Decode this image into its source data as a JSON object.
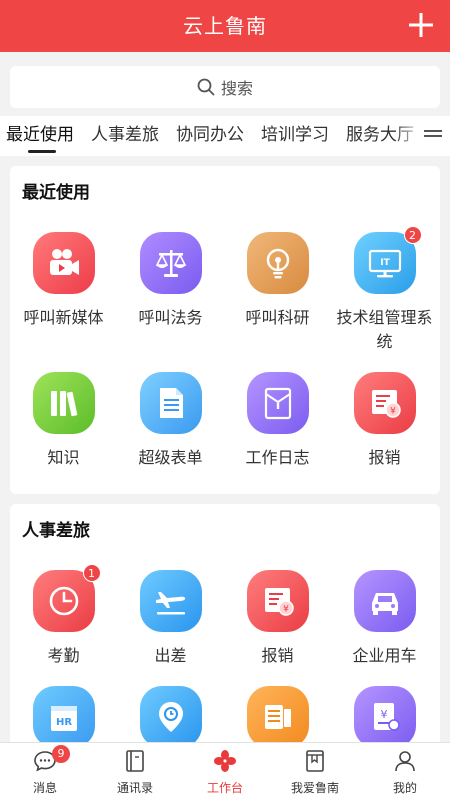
{
  "header": {
    "title": "云上鲁南",
    "add_icon": "plus-icon"
  },
  "search": {
    "placeholder": "搜索",
    "icon": "search-icon"
  },
  "tabs": [
    {
      "label": "最近使用",
      "active": true
    },
    {
      "label": "人事差旅"
    },
    {
      "label": "协同办公"
    },
    {
      "label": "培训学习"
    },
    {
      "label": "服务大厅"
    }
  ],
  "tabs_more_icon": "menu-icon",
  "recent": {
    "title": "最近使用",
    "items": [
      {
        "label": "呼叫新媒体",
        "icon": "video-camera-icon"
      },
      {
        "label": "呼叫法务",
        "icon": "scale-icon"
      },
      {
        "label": "呼叫科研",
        "icon": "lightbulb-icon"
      },
      {
        "label": "技术组管理系统",
        "icon": "it-monitor-icon",
        "badge": "2"
      },
      {
        "label": "知识",
        "icon": "books-icon"
      },
      {
        "label": "超级表单",
        "icon": "form-document-icon"
      },
      {
        "label": "工作日志",
        "icon": "journal-icon"
      },
      {
        "label": "报销",
        "icon": "invoice-icon"
      }
    ]
  },
  "hr_travel": {
    "title": "人事差旅",
    "items": [
      {
        "label": "考勤",
        "icon": "clock-icon",
        "badge": "1"
      },
      {
        "label": "出差",
        "icon": "airplane-icon"
      },
      {
        "label": "报销",
        "icon": "invoice-icon"
      },
      {
        "label": "企业用车",
        "icon": "car-icon"
      },
      {
        "label": "",
        "icon": "hr-folder-icon"
      },
      {
        "label": "",
        "icon": "location-pin-icon"
      },
      {
        "label": "",
        "icon": "ticket-icon"
      },
      {
        "label": "",
        "icon": "yuan-document-icon"
      }
    ]
  },
  "bottom_nav": [
    {
      "label": "消息",
      "icon": "chat-bubble-icon",
      "badge": "9"
    },
    {
      "label": "通讯录",
      "icon": "address-book-icon"
    },
    {
      "label": "工作台",
      "icon": "workbench-icon",
      "active": true
    },
    {
      "label": "我爱鲁南",
      "icon": "bookmark-book-icon"
    },
    {
      "label": "我的",
      "icon": "person-icon"
    }
  ],
  "colors": {
    "brand_red": "#f04545",
    "active_nav": "#e83a3a"
  }
}
